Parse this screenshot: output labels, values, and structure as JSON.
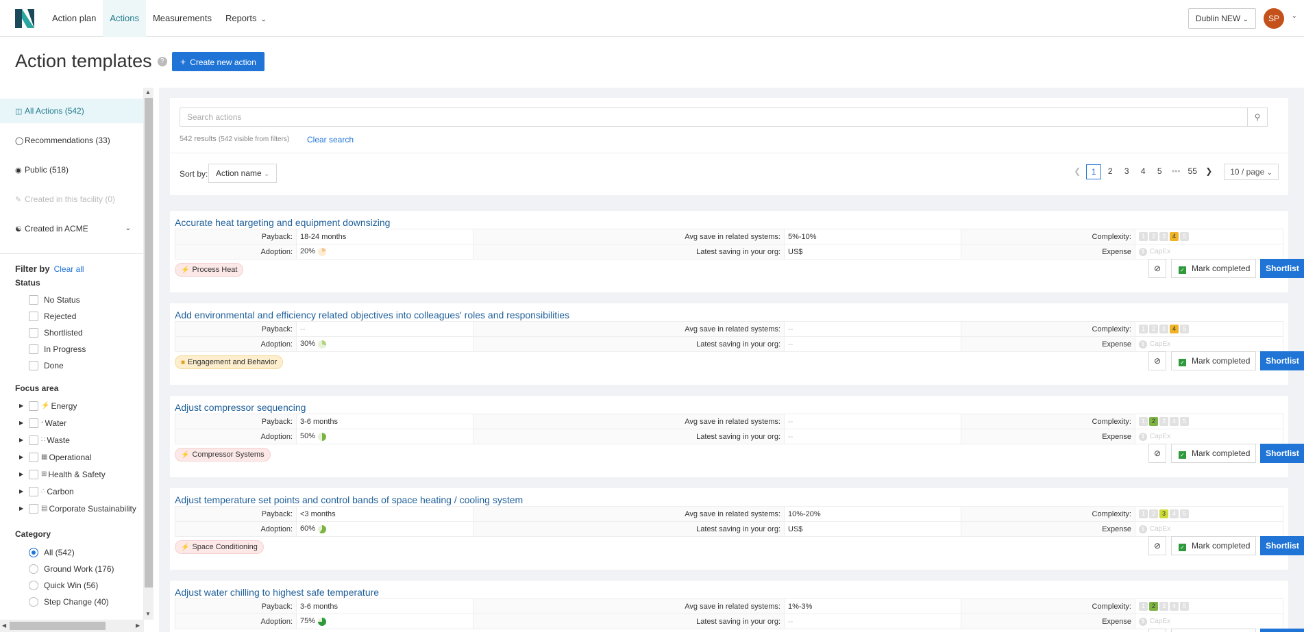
{
  "nav": {
    "links": [
      {
        "label": "Action plan"
      },
      {
        "label": "Actions"
      },
      {
        "label": "Measurements"
      },
      {
        "label": "Reports"
      }
    ],
    "facility": "Dublin NEW",
    "avatar_initials": "SP"
  },
  "page": {
    "title": "Action templates",
    "help": "?",
    "create_button": "Create new action"
  },
  "sidebar": {
    "views": [
      {
        "label": "All Actions (542)",
        "icon": "actions-icon"
      },
      {
        "label": "Recommendations (33)",
        "icon": "bulb-icon"
      },
      {
        "label": "Public (518)",
        "icon": "globe-icon"
      },
      {
        "label": "Created in this facility (0)",
        "icon": "edit-icon"
      },
      {
        "label": "Created in ACME",
        "icon": "users-icon"
      }
    ],
    "filter_by": "Filter by",
    "clear_all": "Clear all",
    "status_heading": "Status",
    "status_options": [
      "No Status",
      "Rejected",
      "Shortlisted",
      "In Progress",
      "Done"
    ],
    "focus_heading": "Focus area",
    "focus_options": [
      "Energy",
      "Water",
      "Waste",
      "Operational",
      "Health & Safety",
      "Carbon",
      "Corporate Sustainability"
    ],
    "category_heading": "Category",
    "category_options": [
      "All (542)",
      "Ground Work (176)",
      "Quick Win (56)",
      "Step Change (40)"
    ]
  },
  "search": {
    "placeholder": "Search actions",
    "results": "542 results",
    "results_detail": "(542 visible from filters)",
    "clear": "Clear search",
    "sort_label": "Sort by:",
    "sort_value": "Action name",
    "pages": [
      "1",
      "2",
      "3",
      "4",
      "5",
      "•••",
      "55"
    ],
    "per_page": "10 / page"
  },
  "labels": {
    "payback": "Payback:",
    "adoption": "Adoption:",
    "avg_save": "Avg save in related systems:",
    "latest_saving": "Latest saving in your org:",
    "complexity": "Complexity:",
    "expense": "Expense",
    "capex": "CapEx",
    "mark_completed": "Mark completed",
    "shortlist": "Shortlist"
  },
  "colors": {
    "primary": "#1f74d6",
    "teal": "#1f7a8c",
    "complexity_orange": "#f0b429",
    "complexity_green": "#7cb342",
    "complexity_lime": "#cddc39"
  },
  "actions": [
    {
      "title": "Accurate heat targeting and equipment downsizing",
      "payback": "18-24 months",
      "adoption": "20%",
      "adoption_pct": 20,
      "avg_save": "5%-10%",
      "latest": "US$",
      "complexity": 4,
      "tag": "Process Heat",
      "tag_style": "red"
    },
    {
      "title": "Add environmental and efficiency related objectives into colleagues' roles and responsibilities",
      "payback": "--",
      "adoption": "30%",
      "adoption_pct": 30,
      "avg_save": "--",
      "latest": "--",
      "complexity": 4,
      "tag": "Engagement and Behavior",
      "tag_style": "yellow"
    },
    {
      "title": "Adjust compressor sequencing",
      "payback": "3-6 months",
      "adoption": "50%",
      "adoption_pct": 50,
      "avg_save": "--",
      "latest": "--",
      "complexity": 2,
      "tag": "Compressor Systems",
      "tag_style": "red"
    },
    {
      "title": "Adjust temperature set points and control bands of space heating / cooling system",
      "payback": "<3 months",
      "adoption": "60%",
      "adoption_pct": 60,
      "avg_save": "10%-20%",
      "latest": "US$",
      "complexity": 3,
      "tag": "Space Conditioning",
      "tag_style": "red"
    },
    {
      "title": "Adjust water chilling to highest safe temperature",
      "payback": "3-6 months",
      "adoption": "75%",
      "adoption_pct": 75,
      "avg_save": "1%-3%",
      "latest": "--",
      "complexity": 2,
      "tag": "",
      "tag_style": "red"
    }
  ]
}
